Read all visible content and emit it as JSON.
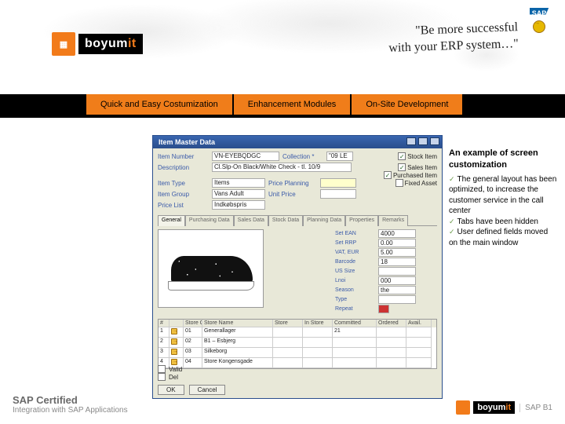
{
  "header": {
    "brand": "boyum",
    "brand_suffix": "it",
    "tagline_l1": "\"Be more successful",
    "tagline_l2": "with your ERP system…\"",
    "sap_badge": "SAP"
  },
  "nav": {
    "items": [
      {
        "label": "Quick and Easy Costumization"
      },
      {
        "label": "Enhancement Modules"
      },
      {
        "label": "On-Site Development"
      }
    ]
  },
  "win": {
    "title": "Item Master Data",
    "rows": {
      "item_no_label": "Item Number",
      "item_no_value": "VN-EYEBQDGC",
      "desc_label": "Description",
      "desc_value": "Cl.Slp-On Black/White Check - tl. 10/9",
      "collection_label": "Collection *",
      "collection_value": "\"09 LE",
      "item_type_label": "Item Type",
      "item_type_value": "Items",
      "item_group_label": "Item Group",
      "item_group_value": "Vans Adult",
      "price_list_label": "Price List",
      "price_list_value": "Indkøbspris",
      "price_planning_label": "Price Planning",
      "unit_price_label": "Unit Price"
    },
    "checks": {
      "stock": "Stock Item",
      "sales": "Sales Item",
      "purchased": "Purchased Item",
      "fixed": "Fixed Asset"
    },
    "tabs": [
      "General",
      "Purchasing Data",
      "Sales Data",
      "Stock Data",
      "Planning Data",
      "Properties",
      "Remarks"
    ],
    "kv": [
      {
        "l": "Set EAN",
        "v": "4000"
      },
      {
        "l": "Set RRP",
        "v": "0.00"
      },
      {
        "l": "VAT, EUR",
        "v": "5.00"
      },
      {
        "l": "Barcode",
        "v": "18"
      },
      {
        "l": "US Size",
        "v": ""
      },
      {
        "l": "Lnoi",
        "v": "000"
      },
      {
        "l": "Season",
        "v": "the"
      },
      {
        "l": "Type",
        "v": ""
      },
      {
        "l": "Repeat",
        "v": ""
      }
    ],
    "grid": {
      "headers": [
        "#",
        "",
        "Store Code",
        "Store Name",
        "Store",
        "In Store",
        "Committed",
        "Ordered",
        "Avail."
      ],
      "rows": [
        [
          "1",
          "",
          "01",
          "Generallager",
          "",
          "",
          "21",
          "",
          ""
        ],
        [
          "2",
          "",
          "02",
          "B1 – Esbjerg",
          "",
          "",
          "",
          "",
          ""
        ],
        [
          "3",
          "",
          "03",
          "Silkeborg",
          "",
          "",
          "",
          "",
          ""
        ],
        [
          "4",
          "",
          "04",
          "Store Kongensgade",
          "",
          "",
          "",
          "",
          ""
        ]
      ]
    },
    "footchecks": [
      "Valid",
      "Del"
    ],
    "buttons": {
      "ok": "OK",
      "cancel": "Cancel"
    }
  },
  "callout": {
    "title": "An example of screen customization",
    "b1": "The general layout has been optimized, to increase the customer service in the call center",
    "b2": "Tabs have been hidden",
    "b3": "User defined fields moved on the main window"
  },
  "footer": {
    "cert1": "SAP Certified",
    "cert2": "Integration with SAP Applications",
    "b1": "SAP B1"
  }
}
